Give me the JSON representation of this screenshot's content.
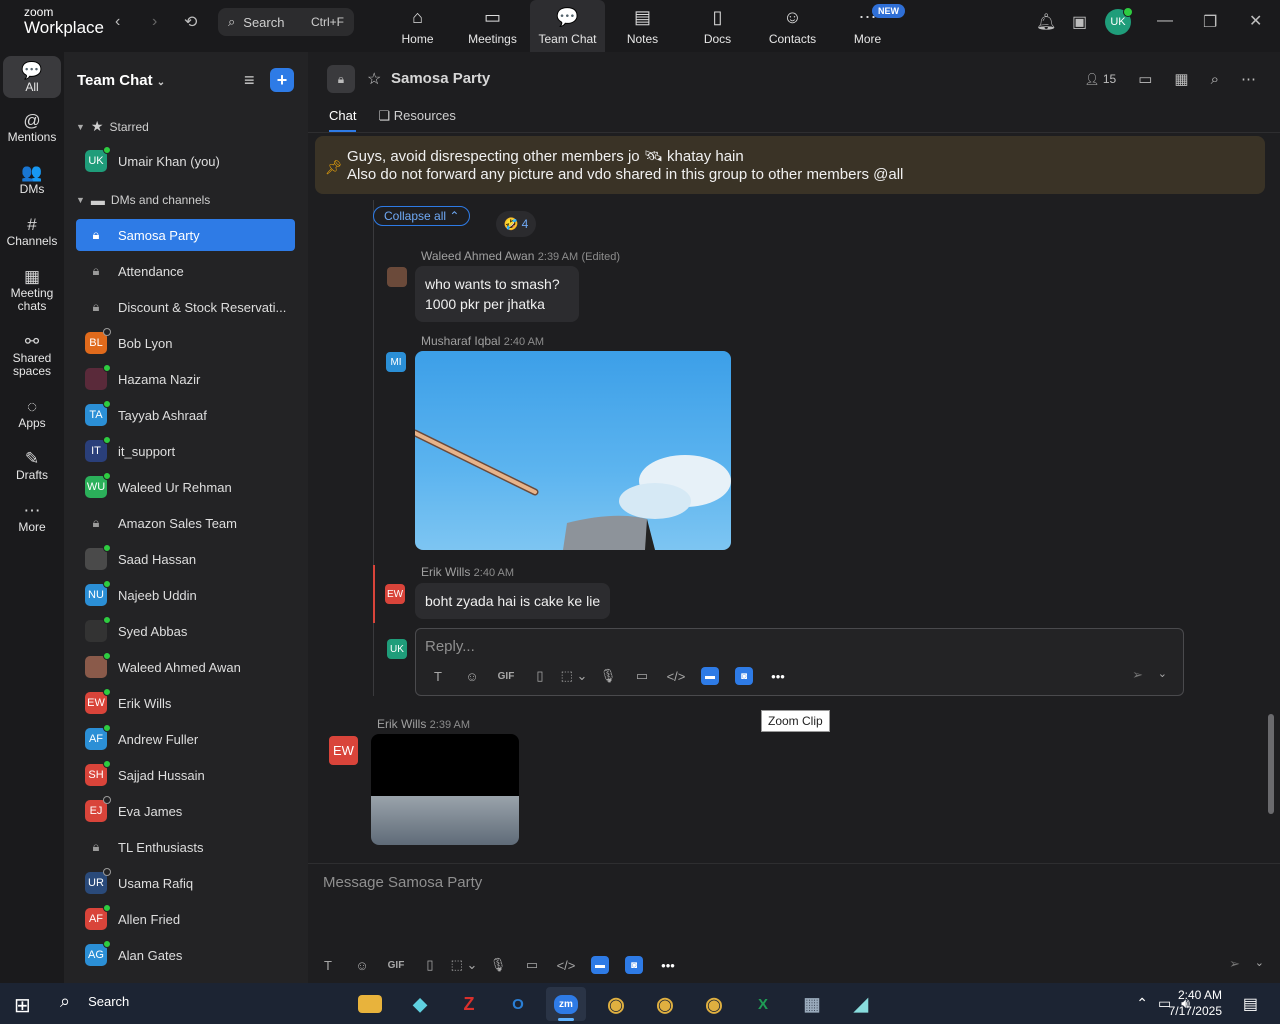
{
  "app": {
    "brand_top": "zoom",
    "brand_bottom": "Workplace"
  },
  "topbar": {
    "search_label": "Search",
    "search_shortcut": "Ctrl+F",
    "tabs": [
      {
        "label": "Home",
        "icon": "⌂"
      },
      {
        "label": "Meetings",
        "icon": "▭"
      },
      {
        "label": "Team Chat",
        "icon": "💬"
      },
      {
        "label": "Notes",
        "icon": "▤"
      },
      {
        "label": "Docs",
        "icon": "▯"
      },
      {
        "label": "Contacts",
        "icon": "☺"
      },
      {
        "label": "More",
        "icon": "⋯"
      }
    ],
    "new_badge": "NEW",
    "user_initials": "UK"
  },
  "rail": [
    {
      "label": "All",
      "icon": "💬"
    },
    {
      "label": "Mentions",
      "icon": "@"
    },
    {
      "label": "DMs",
      "icon": "👥"
    },
    {
      "label": "Channels",
      "icon": "#"
    },
    {
      "label": "Meeting chats",
      "icon": "▦"
    },
    {
      "label": "Shared spaces",
      "icon": "⚯"
    },
    {
      "label": "Apps",
      "icon": "◌"
    },
    {
      "label": "Drafts",
      "icon": "✎"
    },
    {
      "label": "More",
      "icon": "⋯"
    }
  ],
  "sidebar": {
    "title": "Team Chat",
    "starred_label": "Starred",
    "dms_label": "DMs and channels",
    "starred": [
      {
        "name": "Umair Khan (you)",
        "initials": "UK",
        "color": "#1f9d7a",
        "status": "online"
      }
    ],
    "items": [
      {
        "name": "Samosa Party",
        "type": "lock",
        "active": true
      },
      {
        "name": "Attendance",
        "type": "lock"
      },
      {
        "name": "Discount & Stock Reservati...",
        "type": "lock"
      },
      {
        "name": "Bob Lyon",
        "initials": "BL",
        "color": "#e06a1c",
        "status": "offline"
      },
      {
        "name": "Hazama Nazir",
        "initials": "",
        "color": "#5a2a3a",
        "status": "online"
      },
      {
        "name": "Tayyab Ashraaf",
        "initials": "TA",
        "color": "#2b8fd6",
        "status": "online"
      },
      {
        "name": "it_support",
        "initials": "IT",
        "color": "#2a3f7a",
        "status": "online"
      },
      {
        "name": "Waleed Ur Rehman",
        "initials": "WU",
        "color": "#2bb05a",
        "status": "online"
      },
      {
        "name": "Amazon Sales Team",
        "type": "lock"
      },
      {
        "name": "Saad Hassan",
        "initials": "",
        "color": "#4a4a4a",
        "status": "online"
      },
      {
        "name": "Najeeb Uddin",
        "initials": "NU",
        "color": "#2b8fd6",
        "status": "online"
      },
      {
        "name": "Syed Abbas",
        "initials": "",
        "color": "#333333",
        "status": "online"
      },
      {
        "name": "Waleed Ahmed Awan",
        "initials": "",
        "color": "#8a5a4a",
        "status": "online"
      },
      {
        "name": "Erik Wills",
        "initials": "EW",
        "color": "#d9443a",
        "status": "online"
      },
      {
        "name": "Andrew Fuller",
        "initials": "AF",
        "color": "#2b8fd6",
        "status": "online"
      },
      {
        "name": "Sajjad Hussain",
        "initials": "SH",
        "color": "#d9443a",
        "status": "online"
      },
      {
        "name": "Eva James",
        "initials": "EJ",
        "color": "#d9443a",
        "status": "offline"
      },
      {
        "name": "TL Enthusiasts",
        "type": "lock"
      },
      {
        "name": "Usama Rafiq",
        "initials": "UR",
        "color": "#2a4a7a",
        "status": "offline"
      },
      {
        "name": "Allen Fried",
        "initials": "AF",
        "color": "#d9443a",
        "status": "online"
      },
      {
        "name": "Alan Gates",
        "initials": "AG",
        "color": "#2b8fd6",
        "status": "online"
      }
    ]
  },
  "channel": {
    "title": "Samosa Party",
    "member_count": "15",
    "tabs": [
      "Chat",
      "Resources"
    ],
    "pinned_line1": "Guys, avoid disrespecting other members jo 🛰 khatay hain",
    "pinned_line2": "Also do not forward any picture and vdo shared in this group to other members @all",
    "collapse_label": "Collapse all ⌃",
    "reaction_emoji": "🤣",
    "reaction_count": "4"
  },
  "messages": [
    {
      "author": "Waleed Ahmed Awan",
      "time": "2:39 AM",
      "edited": "(Edited)",
      "line1": "who wants to smash?",
      "line2": "1000 pkr per jhatka"
    },
    {
      "author": "Musharaf Iqbal",
      "time": "2:40 AM",
      "initials": "MI"
    },
    {
      "author": "Erik Wills",
      "time": "2:40 AM",
      "initials": "EW",
      "text": "boht zyada hai is cake ke lie"
    },
    {
      "author": "Erik Wills",
      "time": "2:39 AM",
      "initials": "EW"
    }
  ],
  "reply": {
    "placeholder": "Reply...",
    "user_initials": "UK",
    "tooltip": "Zoom Clip"
  },
  "compose": {
    "placeholder": "Message Samosa Party"
  },
  "taskbar": {
    "search_label": "Search",
    "time": "2:40 AM",
    "date": "7/17/2025"
  }
}
